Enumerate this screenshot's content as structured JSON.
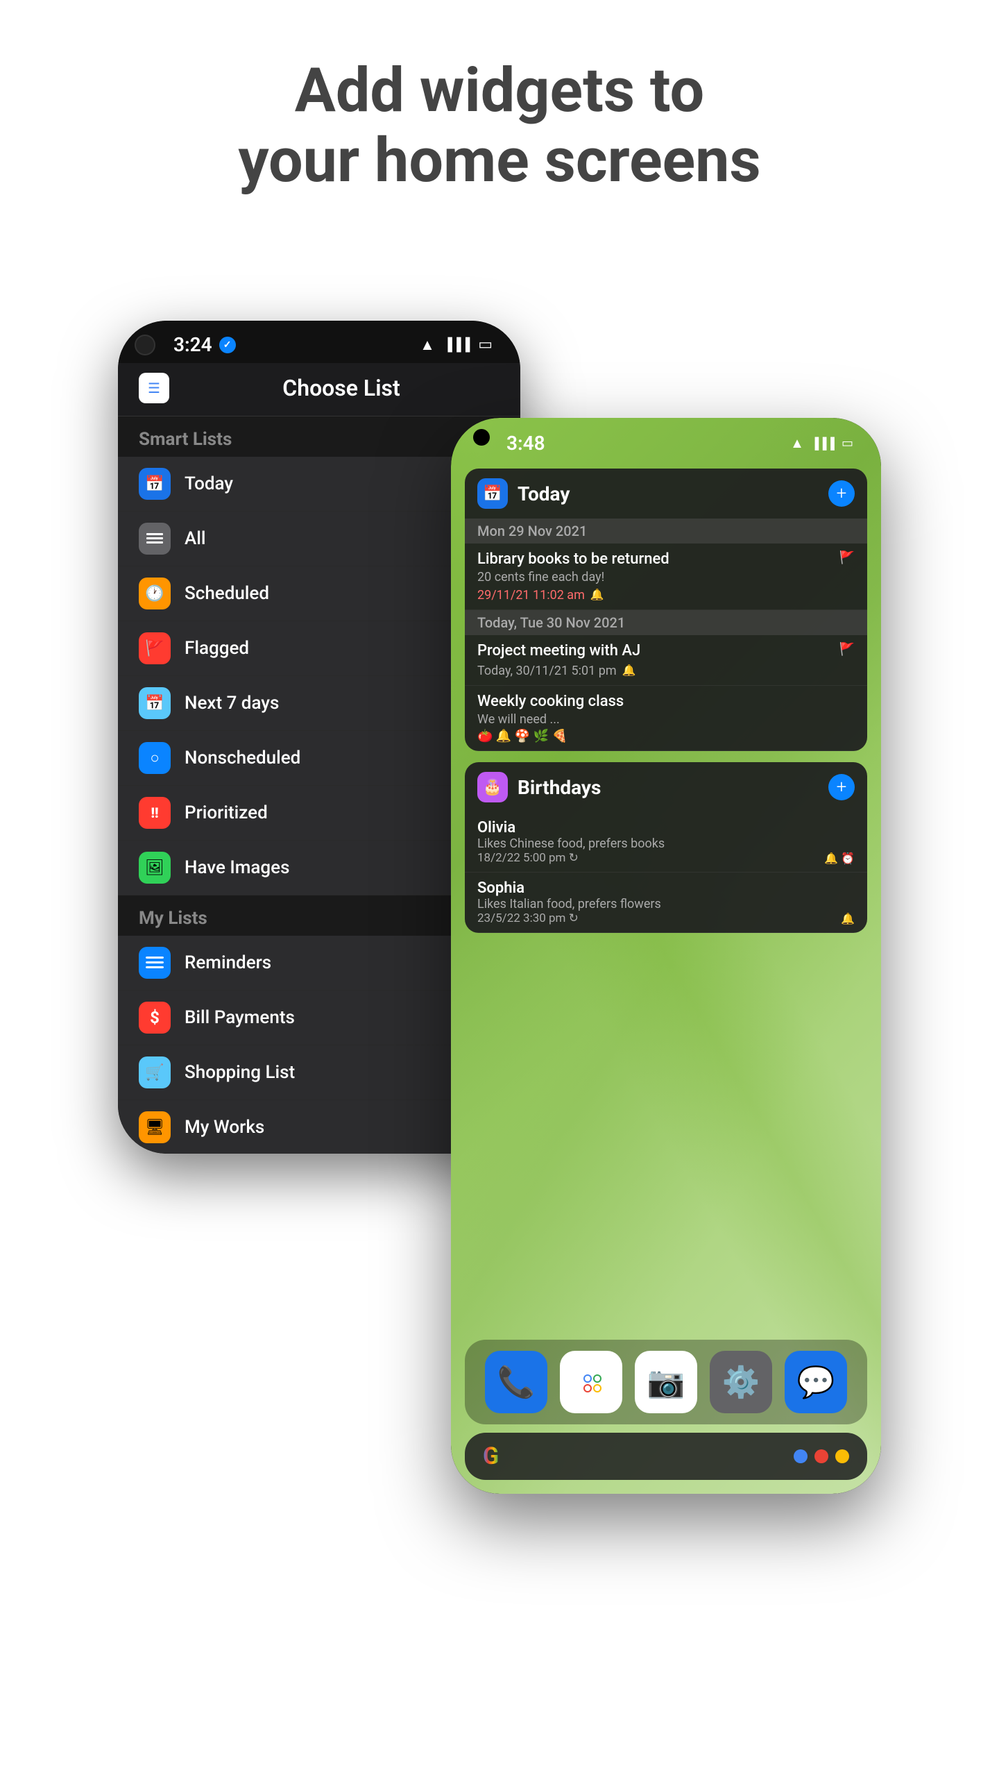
{
  "headline": {
    "line1": "Add widgets to",
    "line2": "your home screens"
  },
  "back_phone": {
    "status": {
      "time": "3:24",
      "verified_icon": "✓",
      "wifi": "wifi",
      "signal": "signal",
      "battery": "battery"
    },
    "header": {
      "app_icon": "☰",
      "title": "Choose List"
    },
    "smart_lists_section": "Smart Lists",
    "smart_lists": [
      {
        "icon": "📅",
        "color": "#1a73e8",
        "label": "Today"
      },
      {
        "icon": "☰",
        "color": "#636366",
        "label": "All"
      },
      {
        "icon": "🕐",
        "color": "#ff9500",
        "label": "Scheduled"
      },
      {
        "icon": "🚩",
        "color": "#ff3b30",
        "label": "Flagged"
      },
      {
        "icon": "📅",
        "color": "#5ac8fa",
        "label": "Next 7 days"
      },
      {
        "icon": "⊙",
        "color": "#0a84ff",
        "label": "Nonscheduled"
      },
      {
        "icon": "‼",
        "color": "#ff3b30",
        "label": "Prioritized"
      },
      {
        "icon": "🖼",
        "color": "#30d158",
        "label": "Have Images"
      }
    ],
    "my_lists_section": "My Lists",
    "my_lists": [
      {
        "icon": "☰",
        "color": "#0a84ff",
        "label": "Reminders"
      },
      {
        "icon": "$",
        "color": "#ff3b30",
        "label": "Bill Payments"
      },
      {
        "icon": "🛒",
        "color": "#5ac8fa",
        "label": "Shopping List"
      },
      {
        "icon": "🖥",
        "color": "#ff9500",
        "label": "My Works"
      }
    ],
    "scroll_indicator": true
  },
  "front_phone": {
    "status": {
      "time": "3:48",
      "wifi": "wifi",
      "signal": "signal",
      "battery": "battery"
    },
    "widget_today": {
      "icon": "📅",
      "icon_color": "#1a73e8",
      "title": "Today",
      "add_button": "+",
      "sections": [
        {
          "date_label": "Mon 29 Nov 2021",
          "tasks": [
            {
              "title": "Library books to be returned",
              "subtitle": "20 cents fine each day!",
              "time": "29/11/21 11:02 am",
              "flagged": true,
              "bell": true
            }
          ]
        },
        {
          "date_label": "Today, Tue 30 Nov 2021",
          "tasks": [
            {
              "title": "Project meeting with AJ",
              "subtitle": "Today, 30/11/21 5:01 pm",
              "flagged": true,
              "bell": true
            },
            {
              "title": "Weekly cooking class",
              "subtitle": "We will need ...",
              "emojis": "🍅🔔🍄🌿🍕"
            }
          ]
        }
      ]
    },
    "widget_birthdays": {
      "icon": "🎂",
      "icon_color": "#bf5af2",
      "title": "Birthdays",
      "add_button": "+",
      "items": [
        {
          "name": "Olivia",
          "detail": "Likes Chinese food, prefers books",
          "date": "18/2/22 5:00 pm",
          "repeat": true,
          "bell": true,
          "alarm": true
        },
        {
          "name": "Sophia",
          "detail": "Likes Italian food, prefers flowers",
          "date": "23/5/22 3:30 pm",
          "repeat": true,
          "bell": true
        }
      ]
    },
    "dock": [
      {
        "icon": "📞",
        "bg": "#1a73e8",
        "label": "phone"
      },
      {
        "icon": "✅",
        "bg": "#ffffff",
        "label": "reminders-app"
      },
      {
        "icon": "📷",
        "bg": "#ffffff",
        "label": "camera"
      },
      {
        "icon": "⚙️",
        "bg": "#1a73e8",
        "label": "settings"
      },
      {
        "icon": "💬",
        "bg": "#1a73e8",
        "label": "messages"
      }
    ],
    "google_bar": {
      "logo": "G",
      "dots": [
        "#4285F4",
        "#EA4335",
        "#FBBC05"
      ]
    }
  }
}
